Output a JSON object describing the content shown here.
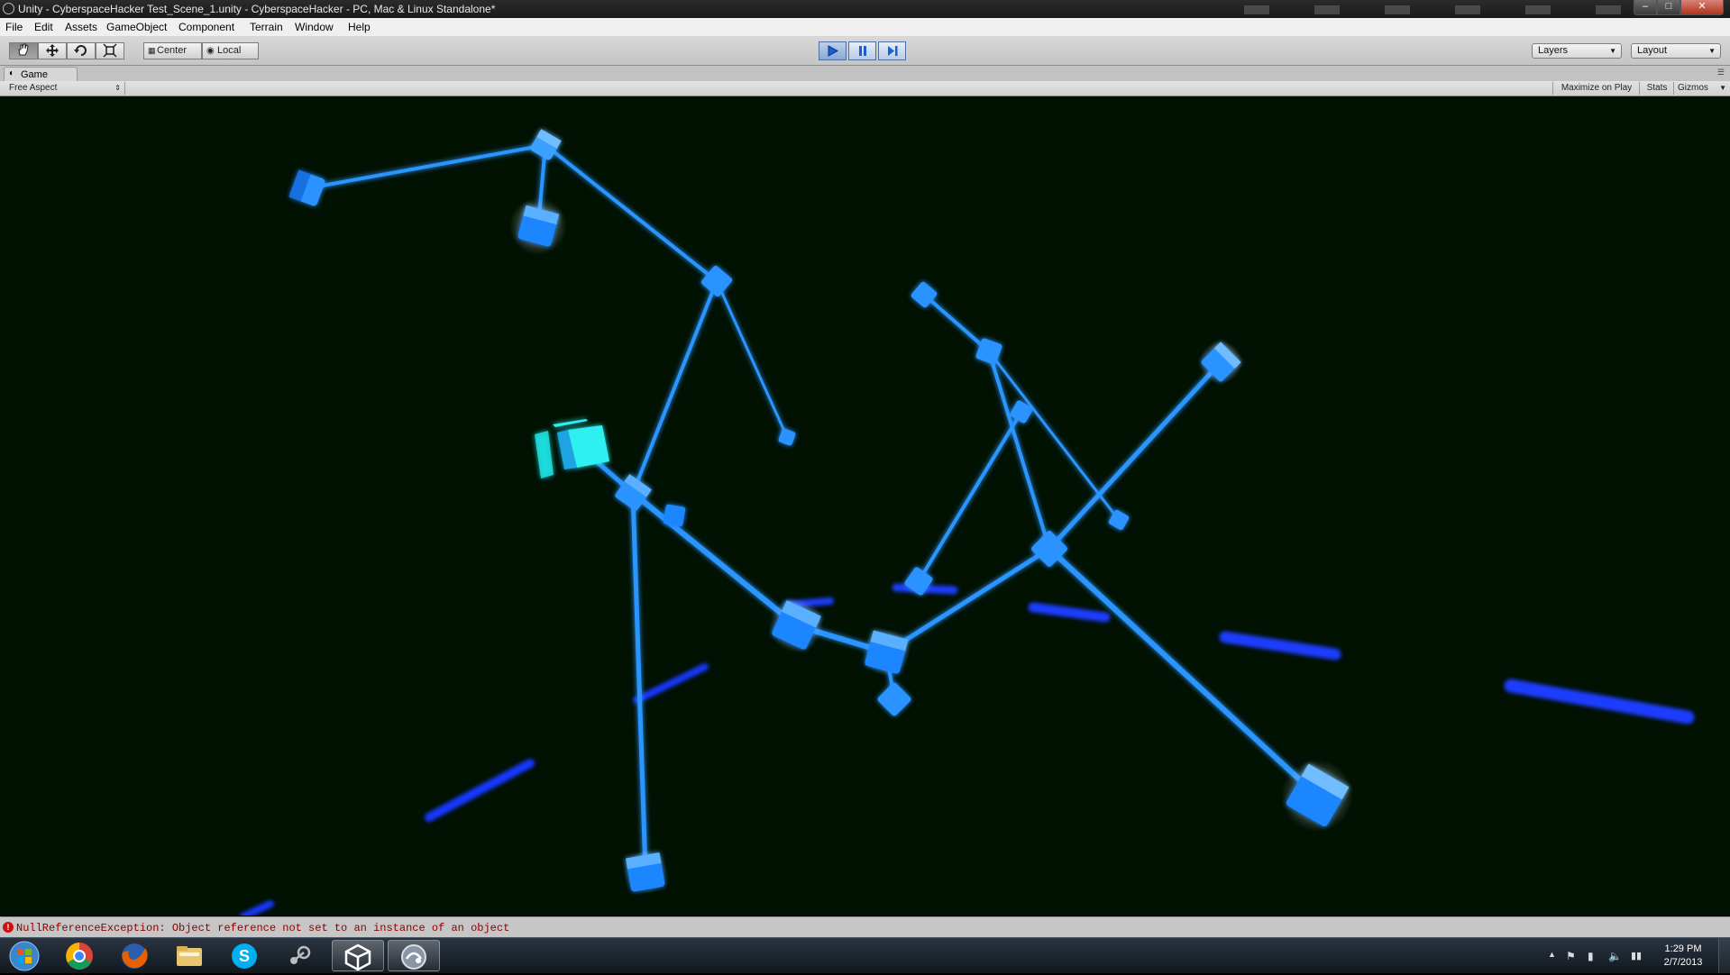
{
  "window": {
    "title": "Unity - CyberspaceHacker Test_Scene_1.unity - CyberspaceHacker - PC, Mac & Linux Standalone*",
    "minimize_icon": "minimize-icon",
    "maximize_icon": "maximize-icon",
    "close_icon": "close-icon"
  },
  "menu": [
    "File",
    "Edit",
    "Assets",
    "GameObject",
    "Component",
    "Terrain",
    "Window",
    "Help"
  ],
  "toolbar": {
    "tools": [
      "hand-icon",
      "move-icon",
      "rotate-icon",
      "scale-icon"
    ],
    "pivot_label": "Center",
    "space_label": "Local",
    "playback": [
      "play-icon",
      "pause-icon",
      "step-icon"
    ],
    "layers_label": "Layers",
    "layout_label": "Layout"
  },
  "game_view": {
    "tab_label": "Game",
    "aspect_label": "Free Aspect",
    "maximize_on_play": "Maximize on Play",
    "stats": "Stats",
    "gizmos": "Gizmos"
  },
  "scene": {
    "background_color": "#011102",
    "node_color": "#1e8fff",
    "line_color": "#2a93ff",
    "bar_color": "#1a3cff",
    "highlight_color": "#2ff0f0"
  },
  "console": {
    "error_message": "NullReferenceException: Object reference not set to an instance of an object"
  },
  "taskbar": {
    "apps": [
      "windows-start-icon",
      "chrome-icon",
      "firefox-icon",
      "file-explorer-icon",
      "skype-icon",
      "steam-icon",
      "unity-icon",
      "monodevelop-icon"
    ],
    "time": "1:29 PM",
    "date": "2/7/2013"
  }
}
